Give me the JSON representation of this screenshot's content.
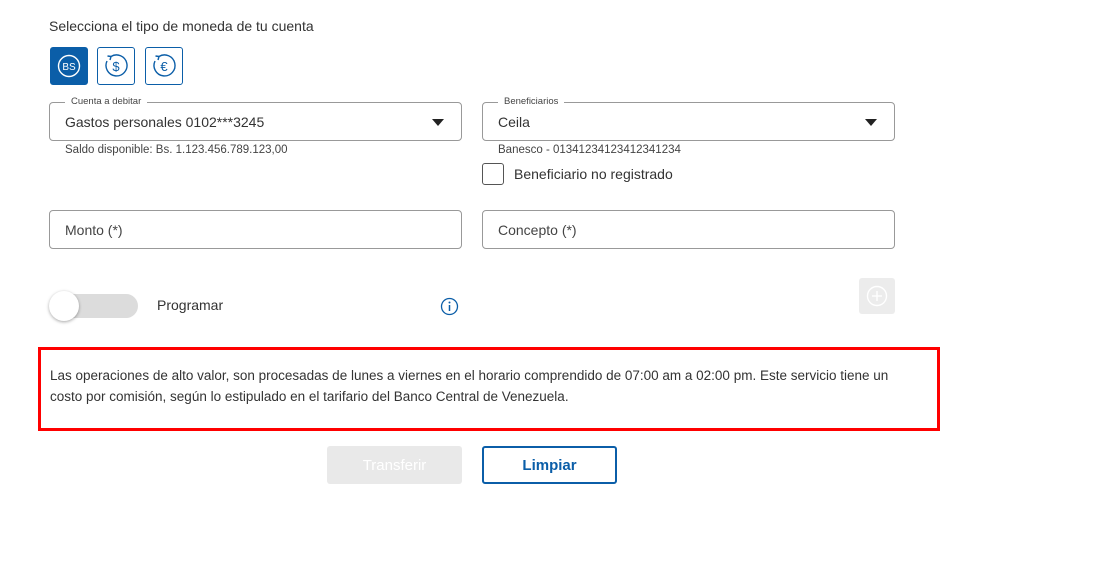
{
  "heading": "Selecciona el tipo de moneda de tu cuenta",
  "currencies": [
    {
      "name": "bolivar",
      "symbol": "BS",
      "selected": true
    },
    {
      "name": "dollar",
      "symbol": "$",
      "selected": false
    },
    {
      "name": "euro",
      "symbol": "€",
      "selected": false
    }
  ],
  "debit_account": {
    "legend": "Cuenta a debitar",
    "value": "Gastos personales 0102***3245",
    "helper": "Saldo disponible: Bs. 1.123.456.789.123,00"
  },
  "beneficiary": {
    "legend": "Beneficiarios",
    "value": "Ceila",
    "helper": "Banesco - 01341234123412341234",
    "unregistered_label": "Beneficiario no registrado"
  },
  "amount": {
    "placeholder": "Monto (*)"
  },
  "concept": {
    "placeholder": "Concepto (*)"
  },
  "schedule": {
    "label": "Programar",
    "enabled": false
  },
  "notice": "Las operaciones de alto valor, son procesadas de lunes a viernes en el horario comprendido de 07:00 am a 02:00 pm. Este servicio tiene un costo por comisión, según lo estipulado en el tarifario del Banco Central de Venezuela.",
  "buttons": {
    "transfer": "Transferir",
    "clear": "Limpiar"
  },
  "colors": {
    "accent": "#0b5ea8",
    "notice_border": "#ff0000"
  }
}
